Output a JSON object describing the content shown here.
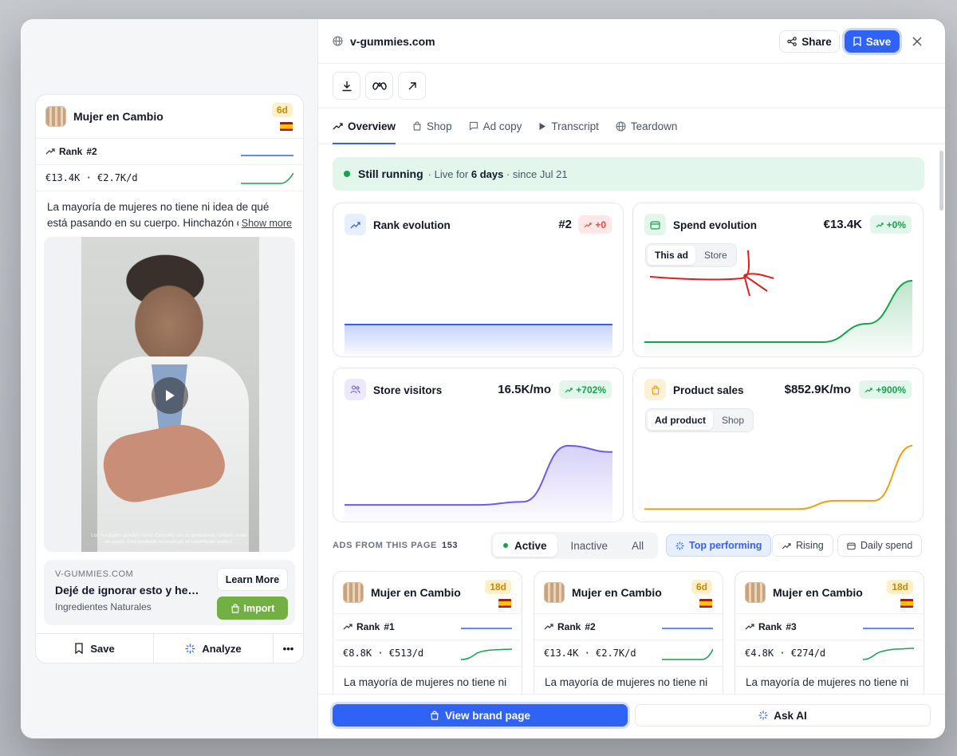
{
  "colors": {
    "accent": "#2f63f5",
    "success": "#16a34a",
    "danger": "#e24b4b",
    "annotation": "#e11d1d",
    "purple": "#6d5ae6",
    "orange": "#f0a00c"
  },
  "left_card": {
    "brand": "Mujer en Cambio",
    "age": "6d",
    "country_flag": "spain-flag",
    "rank_label": "Rank",
    "rank_value": "#2",
    "spend": "€13.4K · €2.7K/d",
    "text": "La mayoría de mujeres no tiene ni idea de qué está pasando en su cuerpo. Hinchazón cons",
    "show_more": "Show more",
    "video_caption": "Los resultados pueden variar. Consulta con un profesional sanitario antes de usarlo. Este producto no sustituye un tratamiento médico.",
    "cta": {
      "domain": "V-GUMMIES.COM",
      "headline": "Dejé de ignorar esto y he…",
      "sub": "Ingredientes Naturales",
      "learn_more": "Learn More",
      "import": "Import"
    },
    "footer": {
      "save": "Save",
      "analyze": "Analyze",
      "more": "•••"
    }
  },
  "header": {
    "domain": "v-gummies.com",
    "share": "Share",
    "save": "Save"
  },
  "tabs": [
    {
      "label": "Overview",
      "icon": "trend-icon"
    },
    {
      "label": "Shop",
      "icon": "bag-icon"
    },
    {
      "label": "Ad copy",
      "icon": "message-icon"
    },
    {
      "label": "Transcript",
      "icon": "play-icon"
    },
    {
      "label": "Teardown",
      "icon": "globe-icon"
    }
  ],
  "status": {
    "title": "Still running",
    "live_prefix": "· Live for",
    "live_days": "6 days",
    "since": "· since Jul 21"
  },
  "panels": {
    "rank": {
      "title": "Rank evolution",
      "value": "#2",
      "delta": "+0",
      "chart_data": {
        "type": "area",
        "values": [
          2,
          2,
          2,
          2,
          2,
          2,
          2
        ]
      }
    },
    "spend": {
      "title": "Spend evolution",
      "value": "€13.4K",
      "delta": "+0%",
      "seg": [
        "This ad",
        "Store"
      ],
      "chart_data": {
        "type": "area",
        "values": [
          0,
          0,
          0,
          0,
          0,
          0.3,
          1
        ]
      }
    },
    "visitors": {
      "title": "Store visitors",
      "value": "16.5K/mo",
      "delta": "+702%",
      "chart_data": {
        "type": "area",
        "values": [
          0.05,
          0.05,
          0.05,
          0.05,
          0.1,
          1,
          0.9
        ]
      }
    },
    "sales": {
      "title": "Product sales",
      "value": "$852.9K/mo",
      "delta": "+900%",
      "seg": [
        "Ad product",
        "Shop"
      ],
      "chart_data": {
        "type": "line",
        "values": [
          0.02,
          0.02,
          0.02,
          0.02,
          0.02,
          0.15,
          0.15,
          1
        ]
      }
    }
  },
  "ads_section": {
    "title": "ADS FROM THIS PAGE",
    "count": "153",
    "filters": [
      "Active",
      "Inactive",
      "All"
    ],
    "sorts": [
      "Top performing",
      "Rising",
      "Daily spend"
    ]
  },
  "mini_cards": [
    {
      "brand": "Mujer en Cambio",
      "age": "18d",
      "rank": "#1",
      "spend": "€8.8K · €513/d",
      "text": "La mayoría de mujeres no tiene ni"
    },
    {
      "brand": "Mujer en Cambio",
      "age": "6d",
      "rank": "#2",
      "spend": "€13.4K · €2.7K/d",
      "text": "La mayoría de mujeres no tiene ni"
    },
    {
      "brand": "Mujer en Cambio",
      "age": "18d",
      "rank": "#3",
      "spend": "€4.8K · €274/d",
      "text": "La mayoría de mujeres no tiene ni"
    }
  ],
  "bottom": {
    "brand_page": "View brand page",
    "ask_ai": "Ask AI"
  }
}
